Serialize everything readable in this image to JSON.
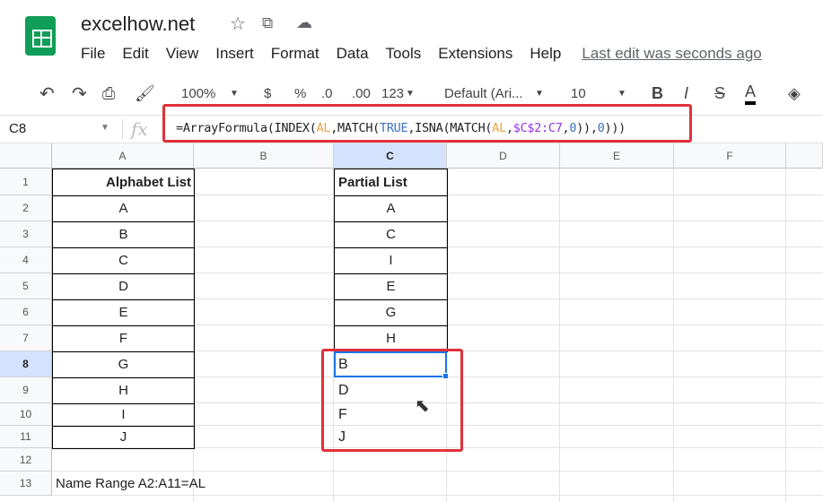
{
  "app": {
    "title": "excelhow.net",
    "menu": [
      "File",
      "Edit",
      "View",
      "Insert",
      "Format",
      "Data",
      "Tools",
      "Extensions",
      "Help"
    ],
    "last_edit": "Last edit was seconds ago"
  },
  "toolbar": {
    "zoom": "100%",
    "currency": "$",
    "percent": "%",
    "dec_decrease": ".0",
    "dec_increase": ".00",
    "format": "123",
    "font": "Default (Ari...",
    "size": "10",
    "bold": "B",
    "italic": "I",
    "strike": "S",
    "text_color": "A"
  },
  "formula_bar": {
    "cell_ref": "C8",
    "fx": "fx",
    "parts": [
      "=ArrayFormula(INDEX(",
      "AL",
      ",MATCH(",
      "TRUE",
      ",ISNA(MATCH(",
      "AL",
      ",",
      "$C$2:C7",
      ",",
      "0",
      ")),",
      "0",
      ")))"
    ]
  },
  "columns": [
    "A",
    "B",
    "C",
    "D",
    "E",
    "F"
  ],
  "rows": [
    "1",
    "2",
    "3",
    "4",
    "5",
    "6",
    "7",
    "8",
    "9",
    "10",
    "11",
    "12",
    "13"
  ],
  "col_a": {
    "header": "Alphabet List",
    "values": [
      "A",
      "B",
      "C",
      "D",
      "E",
      "F",
      "G",
      "H",
      "I",
      "J"
    ]
  },
  "col_c": {
    "header": "Partial List",
    "values": [
      "A",
      "C",
      "I",
      "E",
      "G",
      "H"
    ],
    "results": [
      "B",
      "D",
      "F",
      "J"
    ]
  },
  "note": "Name Range A2:A11=AL",
  "selected_cell": "C8",
  "colors": {
    "accent": "#1a73e8",
    "highlight": "#e0303a"
  }
}
